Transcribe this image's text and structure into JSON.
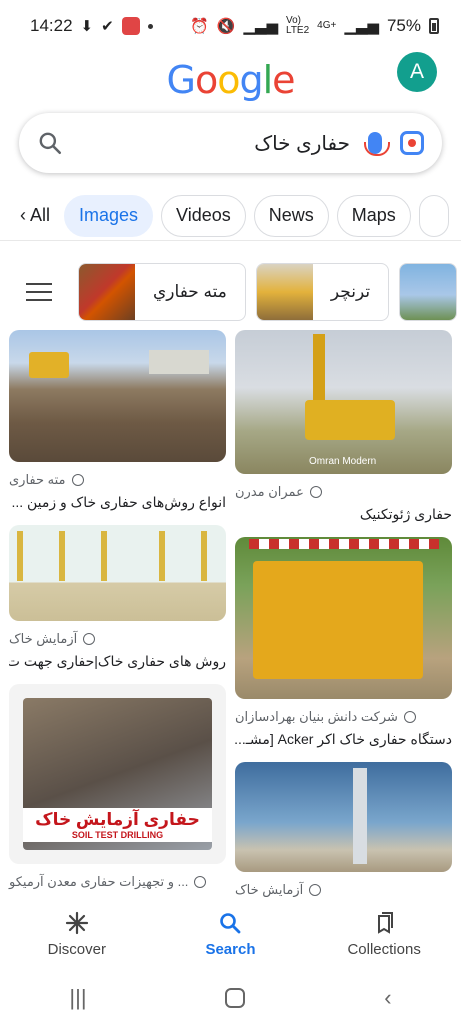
{
  "status_bar": {
    "time": "14:22",
    "network_top": "Vo)",
    "network_bottom": "LTE2",
    "network_4g": "4G+",
    "battery": "75%"
  },
  "header": {
    "logo_letters": [
      "G",
      "o",
      "o",
      "g",
      "l",
      "e"
    ],
    "logo_colors": [
      "#4285f4",
      "#ea4335",
      "#fbbc05",
      "#4285f4",
      "#34a853",
      "#ea4335"
    ],
    "avatar_letter": "A"
  },
  "search": {
    "query": "حفاری خاک"
  },
  "tabs": [
    {
      "label": "All"
    },
    {
      "label": "Images"
    },
    {
      "label": "Videos"
    },
    {
      "label": "News"
    },
    {
      "label": "Maps"
    }
  ],
  "filter_chips": [
    {
      "label": "مته حفاري"
    },
    {
      "label": "ترنچر"
    }
  ],
  "results_left": [
    {
      "source": "مته حفاری",
      "title": "انواع روش‌های حفاری خاک و زمین ..."
    },
    {
      "source": "آزمایش خاک",
      "title": "روش های حفاری خاک|حفاری جهت ت..."
    },
    {
      "source": "... و تجهیزات حفاری معدن آرمیکو",
      "title": "",
      "overlay_title": "حفاری آزمایش خاک",
      "overlay_sub": "SOIL TEST DRILLING"
    }
  ],
  "results_right": [
    {
      "source": "عمران مدرن",
      "title": "حفاری ژئوتکنیک",
      "watermark": "Omran Modern"
    },
    {
      "source": "شرکت دانش بنیان بهرادسازان",
      "title": "دستگاه حفاری خاک اکر Acker [مشـ..."
    },
    {
      "source": "آزمایش خاک",
      "title": ""
    }
  ],
  "bottom_nav": [
    {
      "label": "Discover"
    },
    {
      "label": "Search"
    },
    {
      "label": "Collections"
    }
  ],
  "colors": {
    "accent": "#1a73e8",
    "active_tab_bg": "#e8f0fe"
  }
}
